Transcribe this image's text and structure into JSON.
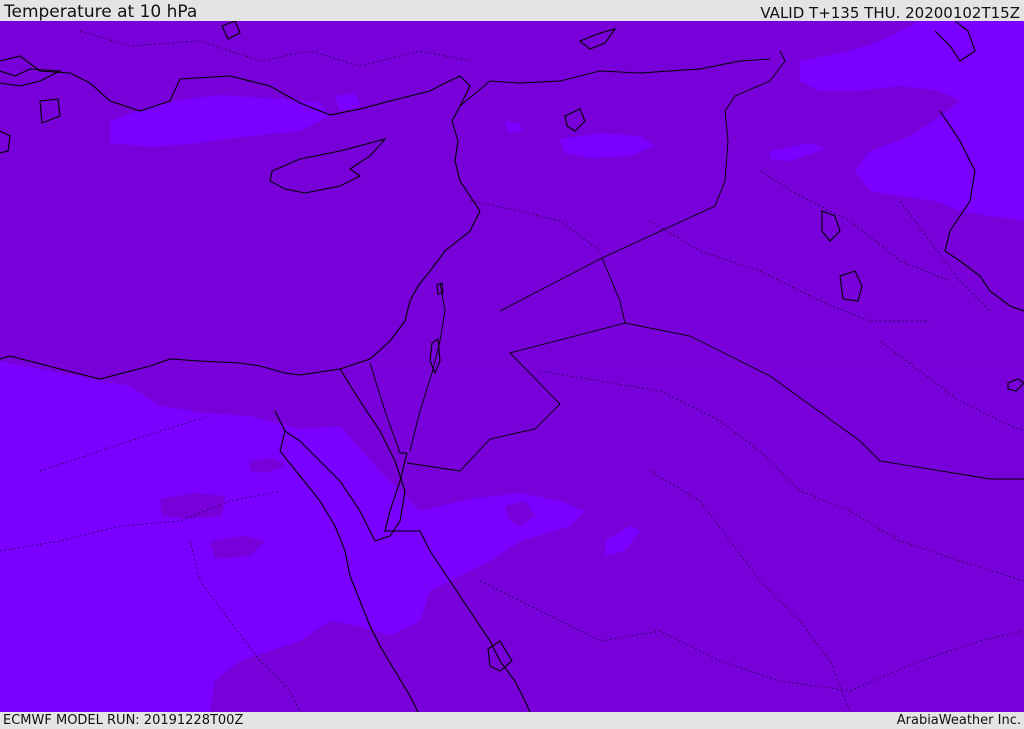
{
  "header": {
    "title": "Temperature at 10 hPa",
    "valid": "VALID T+135 THU. 20200102T15Z"
  },
  "footer": {
    "model_run": "ECMWF MODEL RUN: 20191228T00Z",
    "credit": "ArabiaWeather Inc."
  },
  "map": {
    "fill_colors": {
      "base": "#7800d8",
      "warmer_band": "#7a00ff",
      "coast": "#000000",
      "border": "#000000"
    }
  }
}
